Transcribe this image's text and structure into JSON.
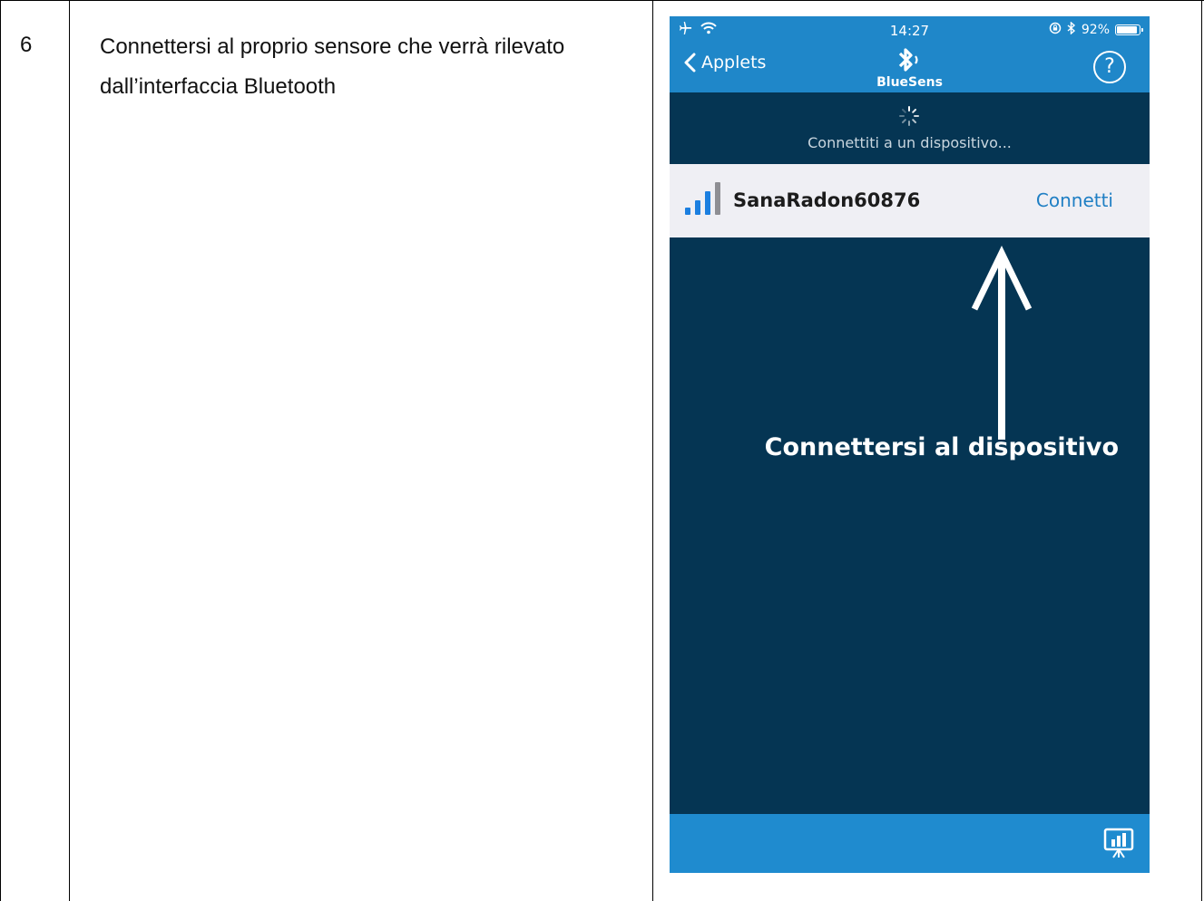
{
  "step": {
    "number": "6",
    "instruction": "Connettersi al proprio sensore che verrà rilevato dall’interfaccia Bluetooth"
  },
  "phone": {
    "status_bar": {
      "time": "14:27",
      "battery": "92%",
      "battery_level": 0.92
    },
    "nav": {
      "back_label": "Applets",
      "app_name": "BlueSens",
      "help_label": "?"
    },
    "connect_status": "Connettiti a un dispositivo...",
    "device": {
      "name": "SanaRadon60876",
      "action": "Connetti",
      "signal_bars_active": 3,
      "signal_bars_total": 4
    },
    "annotation": "Connettersi al dispositivo",
    "colors": {
      "nav_blue": "#1f87c9",
      "dark_navy": "#053553",
      "link_blue": "#1f7fc4",
      "signal_blue": "#1b7fe0",
      "signal_gray": "#8e8e93"
    },
    "icons": {
      "airplane": "airplane-icon",
      "wifi": "wifi-icon",
      "lock_rotation": "lock-rotation-icon",
      "bluetooth": "bluetooth-icon",
      "chart": "presentation-chart-icon"
    }
  }
}
